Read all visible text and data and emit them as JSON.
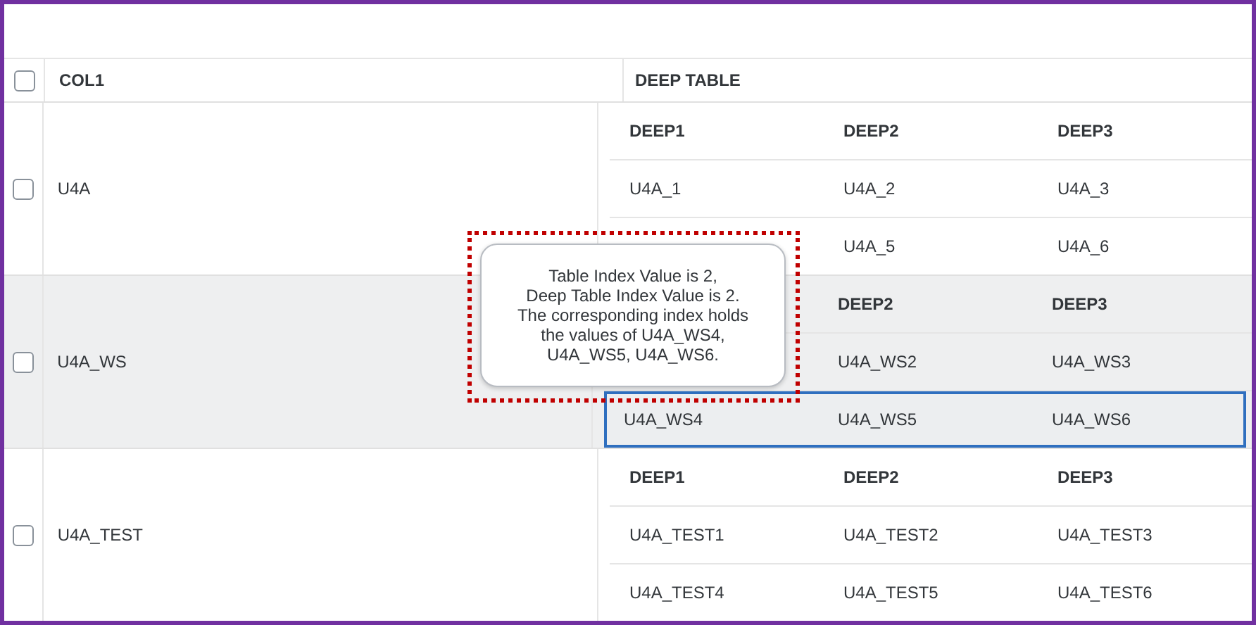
{
  "table": {
    "columns": [
      "COL1",
      "DEEP TABLE"
    ],
    "rows": [
      {
        "col1": "U4A",
        "checked": false,
        "selected": false,
        "deep": {
          "columns": [
            "DEEP1",
            "DEEP2",
            "DEEP3"
          ],
          "rows": [
            {
              "cells": [
                "U4A_1",
                "U4A_2",
                "U4A_3"
              ],
              "selected": false
            },
            {
              "cells": [
                null,
                "U4A_5",
                "U4A_6"
              ],
              "selected": false
            }
          ]
        }
      },
      {
        "col1": "U4A_WS",
        "checked": false,
        "selected": true,
        "deep": {
          "columns": [
            null,
            "DEEP2",
            "DEEP3"
          ],
          "rows": [
            {
              "cells": [
                null,
                "U4A_WS2",
                "U4A_WS3"
              ],
              "selected": false
            },
            {
              "cells": [
                "U4A_WS4",
                "U4A_WS5",
                "U4A_WS6"
              ],
              "selected": true
            }
          ]
        }
      },
      {
        "col1": "U4A_TEST",
        "checked": false,
        "selected": false,
        "deep": {
          "columns": [
            "DEEP1",
            "DEEP2",
            "DEEP3"
          ],
          "rows": [
            {
              "cells": [
                "U4A_TEST1",
                "U4A_TEST2",
                "U4A_TEST3"
              ],
              "selected": false
            },
            {
              "cells": [
                "U4A_TEST4",
                "U4A_TEST5",
                "U4A_TEST6"
              ],
              "selected": false
            }
          ]
        }
      }
    ]
  },
  "header_checkbox": {
    "checked": false
  },
  "tooltip": {
    "lines": [
      "Table Index Value is 2,",
      "Deep Table Index Value is 2.",
      "The corresponding index holds",
      "the values of U4A_WS4,",
      "U4A_WS5, U4A_WS6."
    ]
  }
}
